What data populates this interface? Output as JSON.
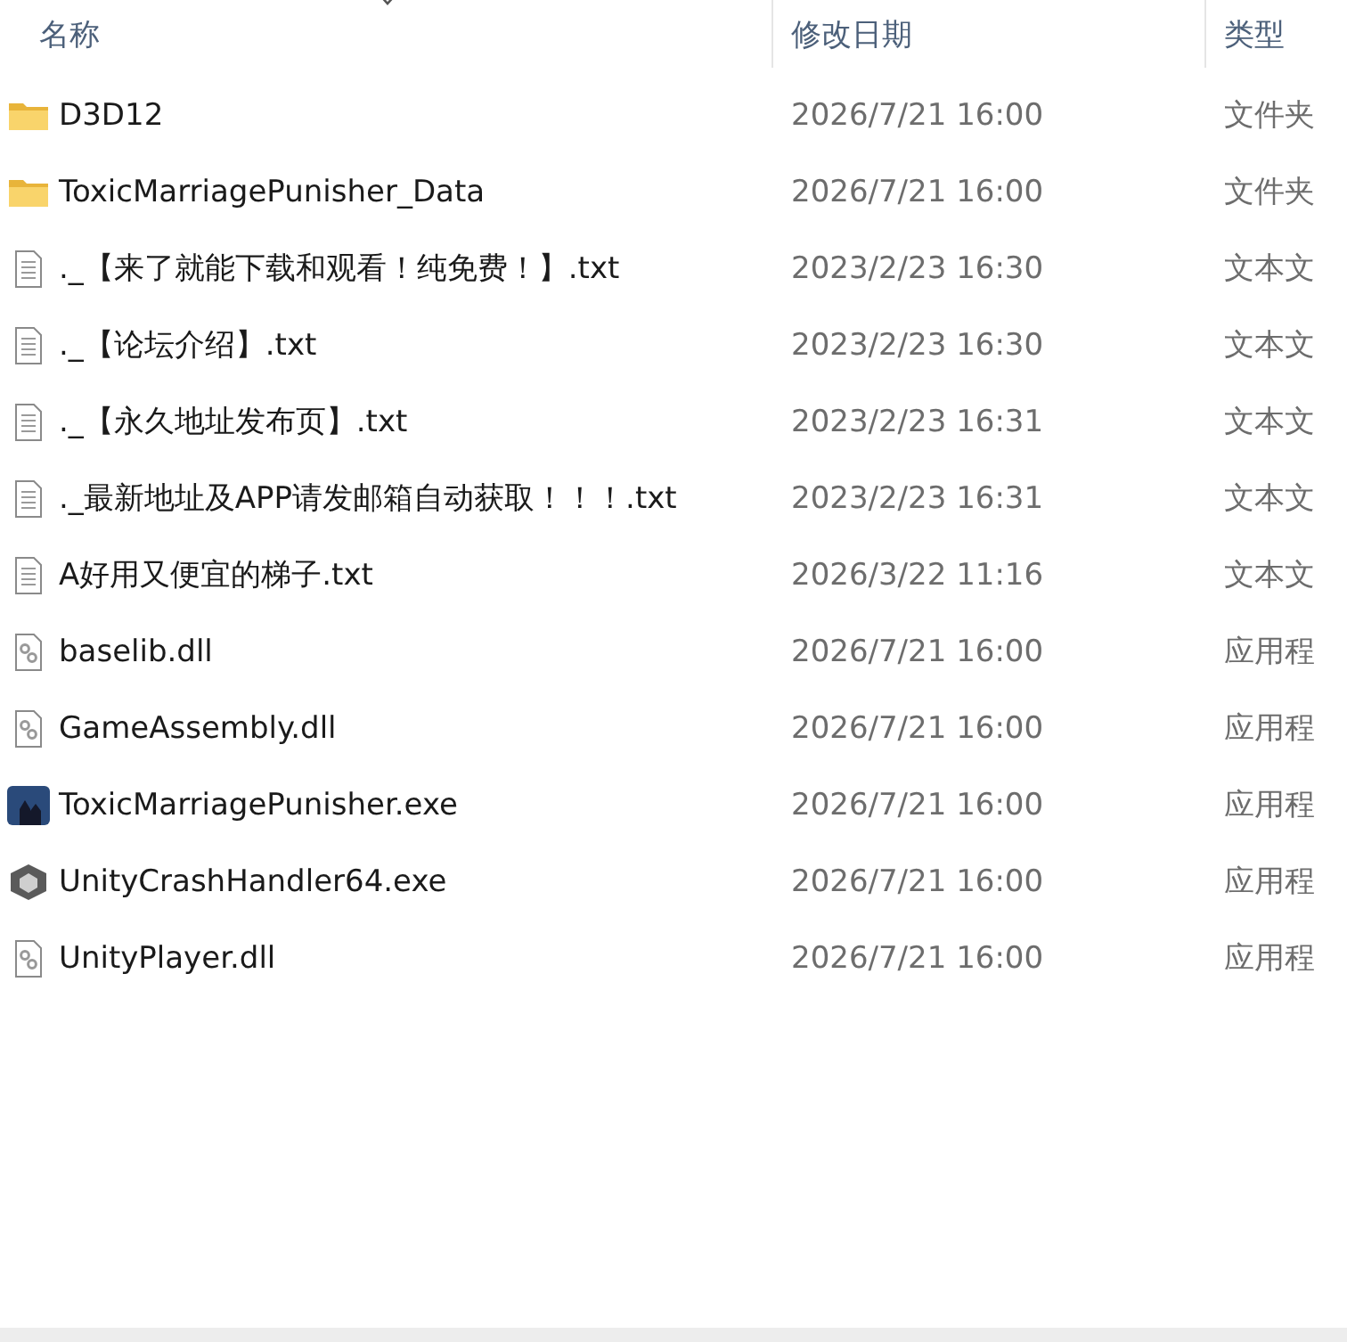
{
  "columns": [
    {
      "label": "名称",
      "sorted": true
    },
    {
      "label": "修改日期",
      "sorted": false
    },
    {
      "label": "类型",
      "sorted": false
    }
  ],
  "files": [
    {
      "kind": "folder",
      "name": "D3D12",
      "date": "2026/7/21 16:00",
      "type": "文件夹"
    },
    {
      "kind": "folder",
      "name": "ToxicMarriagePunisher_Data",
      "date": "2026/7/21 16:00",
      "type": "文件夹"
    },
    {
      "kind": "text",
      "name": "._【来了就能下载和观看！纯免费！】.txt",
      "date": "2023/2/23 16:30",
      "type": "文本文"
    },
    {
      "kind": "text",
      "name": "._【论坛介绍】.txt",
      "date": "2023/2/23 16:30",
      "type": "文本文"
    },
    {
      "kind": "text",
      "name": "._【永久地址发布页】.txt",
      "date": "2023/2/23 16:31",
      "type": "文本文"
    },
    {
      "kind": "text",
      "name": "._最新地址及APP请发邮箱自动获取！！！.txt",
      "date": "2023/2/23 16:31",
      "type": "文本文"
    },
    {
      "kind": "text",
      "name": "A好用又便宜的梯子.txt",
      "date": "2026/3/22 11:16",
      "type": "文本文"
    },
    {
      "kind": "dll",
      "name": "baselib.dll",
      "date": "2026/7/21 16:00",
      "type": "应用程"
    },
    {
      "kind": "dll",
      "name": "GameAssembly.dll",
      "date": "2026/7/21 16:00",
      "type": "应用程"
    },
    {
      "kind": "game",
      "name": "ToxicMarriagePunisher.exe",
      "date": "2026/7/21 16:00",
      "type": "应用程"
    },
    {
      "kind": "unity",
      "name": "UnityCrashHandler64.exe",
      "date": "2026/7/21 16:00",
      "type": "应用程"
    },
    {
      "kind": "dll",
      "name": "UnityPlayer.dll",
      "date": "2026/7/21 16:00",
      "type": "应用程"
    }
  ]
}
